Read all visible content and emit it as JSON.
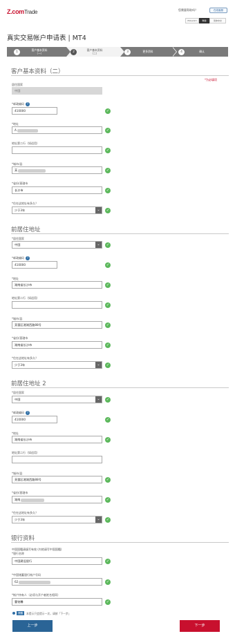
{
  "header": {
    "logo_brand": "Z.com",
    "logo_suffix": "Trade",
    "help_text": "您需要帮助吗？",
    "help_button": "在线客服",
    "languages": [
      "ENGLISH",
      "繁體",
      "简体中文"
    ]
  },
  "page_title": "真实交易帐户申请表 | MT4",
  "steps": [
    {
      "num": "1",
      "label": "客户基本资料\n（一）"
    },
    {
      "num": "2",
      "label": "客户基本资料\n（二）"
    },
    {
      "num": "3",
      "label": "更多资料"
    },
    {
      "num": "4",
      "label": "确认"
    }
  ],
  "required_note": "*为必填项",
  "section1": {
    "title": "客户基本资料（二）",
    "country_label": "居住国家",
    "country_value": "中国",
    "postal_label": "*邮政编码",
    "postal_value": "410000",
    "address_label": "*地址",
    "address_value": "A",
    "address2_label": "地址第二行（如适用）",
    "address2_value": "",
    "district_label": "*城市/县",
    "district_value": "芙",
    "city_label": "*省份/直辖市",
    "city_value": "长沙市",
    "years_label": "*住在这地址有多久？",
    "years_value": "少于3年"
  },
  "section2": {
    "title": "前居住地址",
    "country_label": "*居住国家",
    "country_value": "中国",
    "postal_label": "*邮政编码",
    "postal_value": "410000",
    "address_label": "*地址",
    "address_value": "湖南省长沙市",
    "address2_label": "地址第二行（如适用）",
    "address2_value": "",
    "district_label": "*城市/县",
    "district_value": "芙蓉区湘湖西路88号",
    "city_label": "*省份/直辖市",
    "city_value": "湖南省长沙市",
    "years_label": "*住在这地址有多久？",
    "years_value": "少于3年"
  },
  "section3": {
    "title": "前居住地址 2",
    "country_label": "*居住国家",
    "country_value": "中国",
    "postal_label": "*邮政编码",
    "postal_value": "410000",
    "address_label": "*地址",
    "address_value": "湖南省长沙市",
    "address2_label": "地址第二行（如适用）",
    "address2_value": "",
    "district_label": "*城市/县",
    "district_value": "芙蓉区湘湖西路88号",
    "city_label": "*省份/直辖市",
    "city_value": "湖南",
    "years_label": "*住在这地址有多久？",
    "years_value": "少于3年"
  },
  "section4": {
    "title": "银行资料",
    "bank_note": "中国国籍请填写有效 (内地请写中国国籍)",
    "bank_label": "*银行名称",
    "bank_value": "中国建设银行",
    "account_label": "*中国储蓄银行帐户号码",
    "account_value": "62",
    "holder_label": "*帐户持有人（必须与开户者姓名相同）",
    "holder_value": "曹铭馨"
  },
  "radio": {
    "badge": "提醒",
    "text": "本提示只会提示一次，请按「下一步」"
  },
  "buttons": {
    "prev": "上一步",
    "next": "下一步"
  },
  "colors": {
    "brand_red": "#c8102e",
    "step_gray": "#7a7a7a",
    "check_green": "#5cb85c",
    "prev_blue": "#2a6496"
  }
}
